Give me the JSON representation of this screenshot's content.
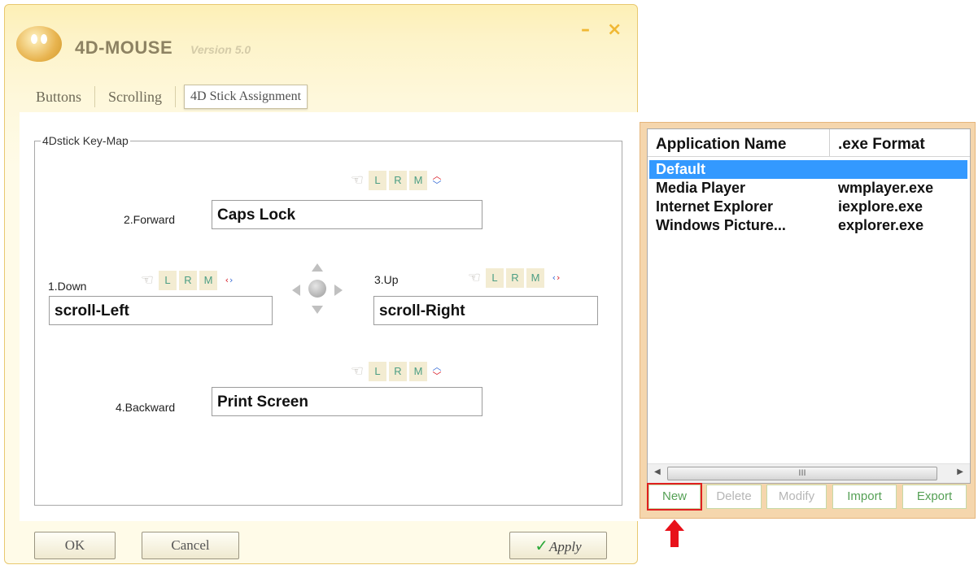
{
  "window": {
    "title": "4D-MOUSE",
    "version": "Version 5.0",
    "minimize": "–",
    "close": "×"
  },
  "tabs": [
    {
      "label": "Buttons"
    },
    {
      "label": "Scrolling"
    },
    {
      "label": "4D Stick Assignment",
      "active": true
    }
  ],
  "keymap": {
    "legend": "4Dstick Key-Map",
    "forward": {
      "label": "2.Forward",
      "value": "Caps Lock"
    },
    "down": {
      "label": "1.Down",
      "value": "scroll-Left"
    },
    "up": {
      "label": "3.Up",
      "value": "scroll-Right"
    },
    "backward": {
      "label": "4.Backward",
      "value": "Print Screen"
    },
    "tool_keys": [
      "L",
      "R",
      "M"
    ]
  },
  "footer": {
    "ok": "OK",
    "cancel": "Cancel",
    "apply": "Apply"
  },
  "app_list": {
    "columns": [
      "Application Name",
      ".exe Format"
    ],
    "rows": [
      {
        "name": "Default",
        "exe": "",
        "selected": true
      },
      {
        "name": "Media Player",
        "exe": "wmplayer.exe"
      },
      {
        "name": "Internet Explorer",
        "exe": "iexplore.exe"
      },
      {
        "name": "Windows Picture...",
        "exe": "explorer.exe"
      }
    ],
    "scroll_thumb": "III"
  },
  "app_buttons": {
    "new": "New",
    "delete": "Delete",
    "modify": "Modify",
    "import": "Import",
    "export": "Export"
  },
  "colors": {
    "accent_red": "#d8202a",
    "selection": "#3399ff",
    "panel_bg": "#f5d6ad",
    "button_text": "#55a055"
  }
}
